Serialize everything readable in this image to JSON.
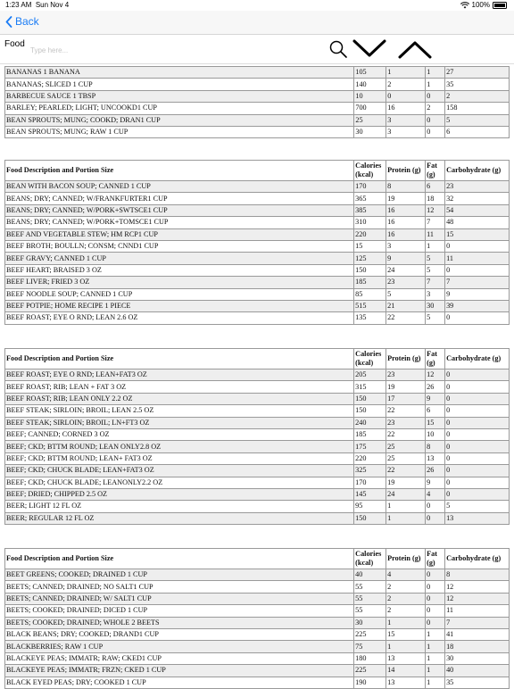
{
  "status": {
    "time": "1:23 AM",
    "date": "Sun Nov 4",
    "battery": "100%"
  },
  "nav": {
    "back_label": "Back"
  },
  "search": {
    "label": "Food",
    "placeholder": "Type here..."
  },
  "headers": [
    "Food Description and Portion Size",
    "Calories (kcal)",
    "Protein (g)",
    "Fat (g)",
    "Carbohydrate (g)"
  ],
  "tables": [
    {
      "header": false,
      "rows": [
        [
          "BANANAS 1 BANANA",
          "105",
          "1",
          "1",
          "27"
        ],
        [
          "BANANAS; SLICED 1 CUP",
          "140",
          "2",
          "1",
          "35"
        ],
        [
          "BARBECUE SAUCE 1 TBSP",
          "10",
          "0",
          "0",
          "2"
        ],
        [
          "BARLEY; PEARLED; LIGHT; UNCOOKD1 CUP",
          "700",
          "16",
          "2",
          "158"
        ],
        [
          "BEAN SPROUTS; MUNG; COOKD; DRAN1 CUP",
          "25",
          "3",
          "0",
          "5"
        ],
        [
          "BEAN SPROUTS; MUNG; RAW 1 CUP",
          "30",
          "3",
          "0",
          "6"
        ]
      ]
    },
    {
      "header": true,
      "rows": [
        [
          "BEAN WITH BACON SOUP; CANNED 1 CUP",
          "170",
          "8",
          "6",
          "23"
        ],
        [
          "BEANS; DRY; CANNED; W/FRANKFURTER1 CUP",
          "365",
          "19",
          "18",
          "32"
        ],
        [
          "BEANS; DRY; CANNED; W/PORK+SWTSCE1 CUP",
          "385",
          "16",
          "12",
          "54"
        ],
        [
          "BEANS; DRY; CANNED; W/PORK+TOMSCE1 CUP",
          "310",
          "16",
          "7",
          "48"
        ],
        [
          "BEEF AND VEGETABLE STEW; HM RCP1 CUP",
          "220",
          "16",
          "11",
          "15"
        ],
        [
          "BEEF BROTH; BOULLN; CONSM; CNND1 CUP",
          "15",
          "3",
          "1",
          "0"
        ],
        [
          "BEEF GRAVY; CANNED 1 CUP",
          "125",
          "9",
          "5",
          "11"
        ],
        [
          "BEEF HEART; BRAISED 3 OZ",
          "150",
          "24",
          "5",
          "0"
        ],
        [
          "BEEF LIVER; FRIED 3 OZ",
          "185",
          "23",
          "7",
          "7"
        ],
        [
          "BEEF NOODLE SOUP; CANNED 1 CUP",
          "85",
          "5",
          "3",
          "9"
        ],
        [
          "BEEF POTPIE; HOME RECIPE 1 PIECE",
          "515",
          "21",
          "30",
          "39"
        ],
        [
          "BEEF ROAST; EYE O RND; LEAN 2.6 OZ",
          "135",
          "22",
          "5",
          "0"
        ]
      ]
    },
    {
      "header": true,
      "rows": [
        [
          "BEEF ROAST; EYE O RND; LEAN+FAT3 OZ",
          "205",
          "23",
          "12",
          "0"
        ],
        [
          "BEEF ROAST; RIB; LEAN + FAT 3 OZ",
          "315",
          "19",
          "26",
          "0"
        ],
        [
          "BEEF ROAST; RIB; LEAN ONLY 2.2 OZ",
          "150",
          "17",
          "9",
          "0"
        ],
        [
          "BEEF STEAK; SIRLOIN; BROIL; LEAN 2.5 OZ",
          "150",
          "22",
          "6",
          "0"
        ],
        [
          "BEEF STEAK; SIRLOIN; BROIL; LN+FT3 OZ",
          "240",
          "23",
          "15",
          "0"
        ],
        [
          "BEEF; CANNED; CORNED 3 OZ",
          "185",
          "22",
          "10",
          "0"
        ],
        [
          "BEEF; CKD; BTTM ROUND; LEAN ONLY2.8 OZ",
          "175",
          "25",
          "8",
          "0"
        ],
        [
          "BEEF; CKD; BTTM ROUND; LEAN+ FAT3 OZ",
          "220",
          "25",
          "13",
          "0"
        ],
        [
          "BEEF; CKD; CHUCK BLADE; LEAN+FAT3 OZ",
          "325",
          "22",
          "26",
          "0"
        ],
        [
          "BEEF; CKD; CHUCK BLADE; LEANONLY2.2 OZ",
          "170",
          "19",
          "9",
          "0"
        ],
        [
          "BEEF; DRIED; CHIPPED 2.5 OZ",
          "145",
          "24",
          "4",
          "0"
        ],
        [
          "BEER; LIGHT 12 FL OZ",
          "95",
          "1",
          "0",
          "5"
        ],
        [
          "BEER; REGULAR 12 FL OZ",
          "150",
          "1",
          "0",
          "13"
        ]
      ]
    },
    {
      "header": true,
      "rows": [
        [
          "BEET GREENS; COOKED; DRAINED 1 CUP",
          "40",
          "4",
          "0",
          "8"
        ],
        [
          "BEETS; CANNED; DRAINED; NO SALT1 CUP",
          "55",
          "2",
          "0",
          "12"
        ],
        [
          "BEETS; CANNED; DRAINED; W/ SALT1 CUP",
          "55",
          "2",
          "0",
          "12"
        ],
        [
          "BEETS; COOKED; DRAINED; DICED 1 CUP",
          "55",
          "2",
          "0",
          "11"
        ],
        [
          "BEETS; COOKED; DRAINED; WHOLE 2 BEETS",
          "30",
          "1",
          "0",
          "7"
        ],
        [
          "BLACK BEANS; DRY; COOKED; DRAND1 CUP",
          "225",
          "15",
          "1",
          "41"
        ],
        [
          "BLACKBERRIES; RAW 1 CUP",
          "75",
          "1",
          "1",
          "18"
        ],
        [
          "BLACKEYE PEAS; IMMATR; RAW; CKED1 CUP",
          "180",
          "13",
          "1",
          "30"
        ],
        [
          "BLACKEYE PEAS; IMMATR; FRZN; CKED 1 CUP",
          "225",
          "14",
          "1",
          "40"
        ],
        [
          "BLACK EYED PEAS; DRY; COOKED 1 CUP",
          "190",
          "13",
          "1",
          "35"
        ]
      ]
    }
  ]
}
